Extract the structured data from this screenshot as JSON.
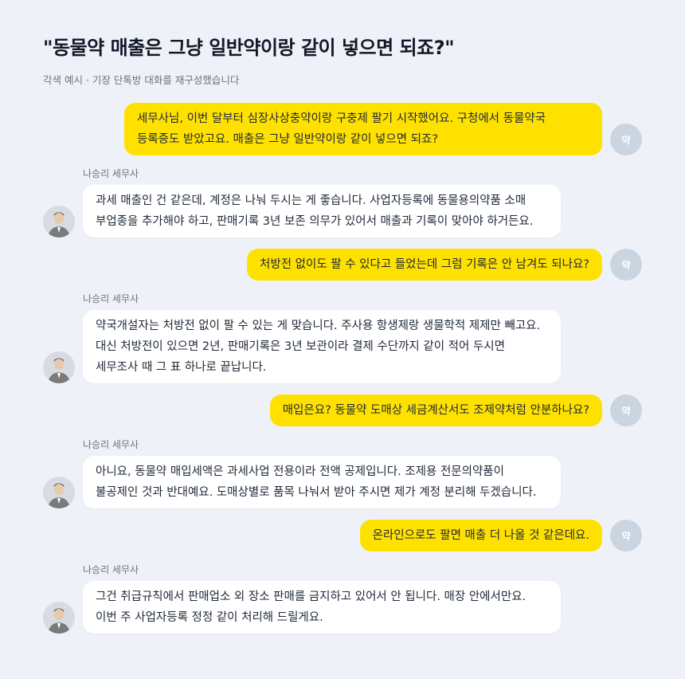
{
  "header": {
    "title": "\"동물약 매출은 그냥 일반약이랑 같이 넣으면 되죠?\"",
    "subtitle": "각색 예시 · 기장 단톡방 대화를 재구성했습니다"
  },
  "user_avatar_label": "약",
  "messages": [
    {
      "role": "user",
      "text": "세무사님, 이번 달부터 심장사상충약이랑 구충제 팔기 시작했어요. 구청에서 동물약국\n등록증도 받았고요. 매출은 그냥 일반약이랑 같이 넣으면 되죠?"
    },
    {
      "role": "bot",
      "sender": "나승리 세무사",
      "text": "과세 매출인 건 같은데, 계정은 나눠 두시는 게 좋습니다. 사업자등록에 동물용의약품 소매\n부업종을 추가해야 하고, 판매기록 3년 보존 의무가 있어서 매출과 기록이 맞아야 하거든요."
    },
    {
      "role": "user",
      "text": "처방전 없이도 팔 수 있다고 들었는데 그럼 기록은 안 남겨도 되나요?"
    },
    {
      "role": "bot",
      "sender": "나승리 세무사",
      "text": "약국개설자는 처방전 없이 팔 수 있는 게 맞습니다. 주사용 항생제랑 생물학적 제제만 빼고요.\n대신 처방전이 있으면 2년, 판매기록은 3년 보관이라 결제 수단까지 같이 적어 두시면\n세무조사 때 그 표 하나로 끝납니다."
    },
    {
      "role": "user",
      "text": "매입은요? 동물약 도매상 세금계산서도 조제약처럼 안분하나요?"
    },
    {
      "role": "bot",
      "sender": "나승리 세무사",
      "text": "아니요, 동물약 매입세액은 과세사업 전용이라 전액 공제입니다. 조제용 전문의약품이\n불공제인 것과 반대예요. 도매상별로 품목 나눠서 받아 주시면 제가 계정 분리해 두겠습니다."
    },
    {
      "role": "user",
      "text": "온라인으로도 팔면 매출 더 나올 것 같은데요."
    },
    {
      "role": "bot",
      "sender": "나승리 세무사",
      "text": "그건 취급규칙에서 판매업소 외 장소 판매를 금지하고 있어서 안 됩니다. 매장 안에서만요.\n이번 주 사업자등록 정정 같이 처리해 드릴게요."
    }
  ]
}
